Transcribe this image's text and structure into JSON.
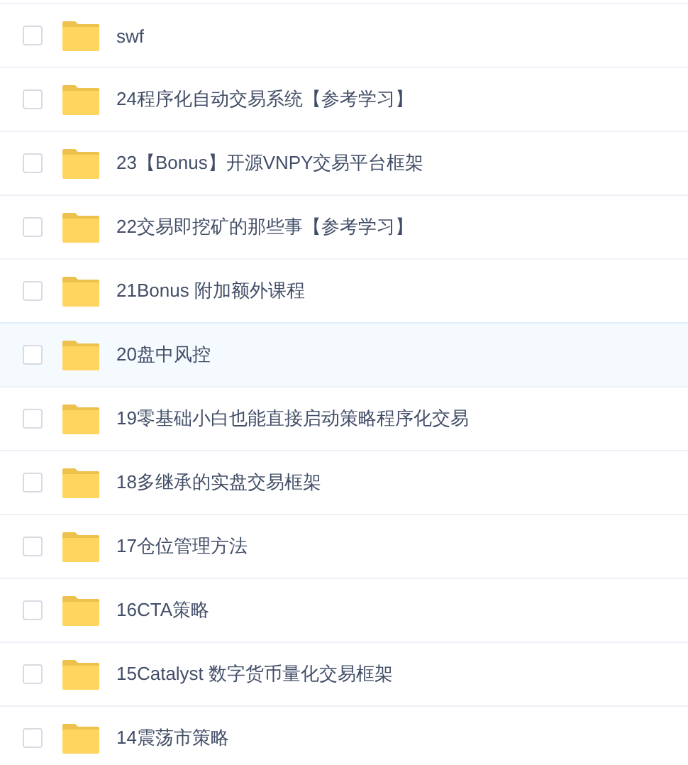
{
  "files": [
    {
      "name": "swf",
      "checked": false,
      "highlighted": false
    },
    {
      "name": "24程序化自动交易系统【参考学习】",
      "checked": false,
      "highlighted": false
    },
    {
      "name": "23【Bonus】开源VNPY交易平台框架",
      "checked": false,
      "highlighted": false
    },
    {
      "name": "22交易即挖矿的那些事【参考学习】",
      "checked": false,
      "highlighted": false
    },
    {
      "name": "21Bonus 附加额外课程",
      "checked": false,
      "highlighted": false
    },
    {
      "name": "20盘中风控",
      "checked": false,
      "highlighted": true
    },
    {
      "name": "19零基础小白也能直接启动策略程序化交易",
      "checked": false,
      "highlighted": false
    },
    {
      "name": "18多继承的实盘交易框架",
      "checked": false,
      "highlighted": false
    },
    {
      "name": "17仓位管理方法",
      "checked": false,
      "highlighted": false
    },
    {
      "name": "16CTA策略",
      "checked": false,
      "highlighted": false
    },
    {
      "name": "15Catalyst 数字货币量化交易框架",
      "checked": false,
      "highlighted": false
    },
    {
      "name": "14震荡市策略",
      "checked": false,
      "highlighted": false
    }
  ]
}
